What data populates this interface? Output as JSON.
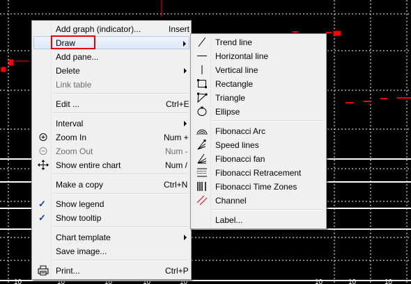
{
  "context_menu": {
    "items": [
      {
        "label": "Add graph (indicator)...",
        "shortcut": "Insert"
      },
      {
        "label": "Draw"
      },
      {
        "label": "Add pane..."
      },
      {
        "label": "Delete"
      },
      {
        "label": "Link table"
      },
      {
        "label": "Edit ...",
        "shortcut": "Ctrl+E"
      },
      {
        "label": "Interval"
      },
      {
        "label": "Zoom In",
        "shortcut": "Num +"
      },
      {
        "label": "Zoom Out",
        "shortcut": "Num -"
      },
      {
        "label": "Show entire chart",
        "shortcut": "Num /"
      },
      {
        "label": "Make a copy",
        "shortcut": "Ctrl+N"
      },
      {
        "label": "Show legend",
        "checked": true
      },
      {
        "label": "Show tooltip",
        "checked": true
      },
      {
        "label": "Chart template"
      },
      {
        "label": "Save image..."
      },
      {
        "label": "Print...",
        "shortcut": "Ctrl+P"
      }
    ]
  },
  "draw_submenu": {
    "items": [
      {
        "label": "Trend line",
        "icon": "trend-line-icon"
      },
      {
        "label": "Horizontal line",
        "icon": "horizontal-line-icon"
      },
      {
        "label": "Vertical line",
        "icon": "vertical-line-icon"
      },
      {
        "label": "Rectangle",
        "icon": "rectangle-icon"
      },
      {
        "label": "Triangle",
        "icon": "triangle-icon"
      },
      {
        "label": "Ellipse",
        "icon": "ellipse-icon"
      },
      {
        "label": "Fibonacci Arc",
        "icon": "fibonacci-arc-icon"
      },
      {
        "label": "Speed lines",
        "icon": "speed-lines-icon"
      },
      {
        "label": "Fibonacci fan",
        "icon": "fibonacci-fan-icon"
      },
      {
        "label": "Fibonacci Retracement",
        "icon": "fibonacci-retracement-icon"
      },
      {
        "label": "Fibonacci Time Zones",
        "icon": "fibonacci-time-zones-icon"
      },
      {
        "label": "Channel",
        "icon": "channel-icon"
      },
      {
        "label": "Label..."
      }
    ]
  },
  "colors": {
    "chart_bg": "#000000",
    "grid": "#ffffff",
    "candle": "#ff0000",
    "highlight_box": "#e00000",
    "menu_bg": "#f0f0f0"
  }
}
